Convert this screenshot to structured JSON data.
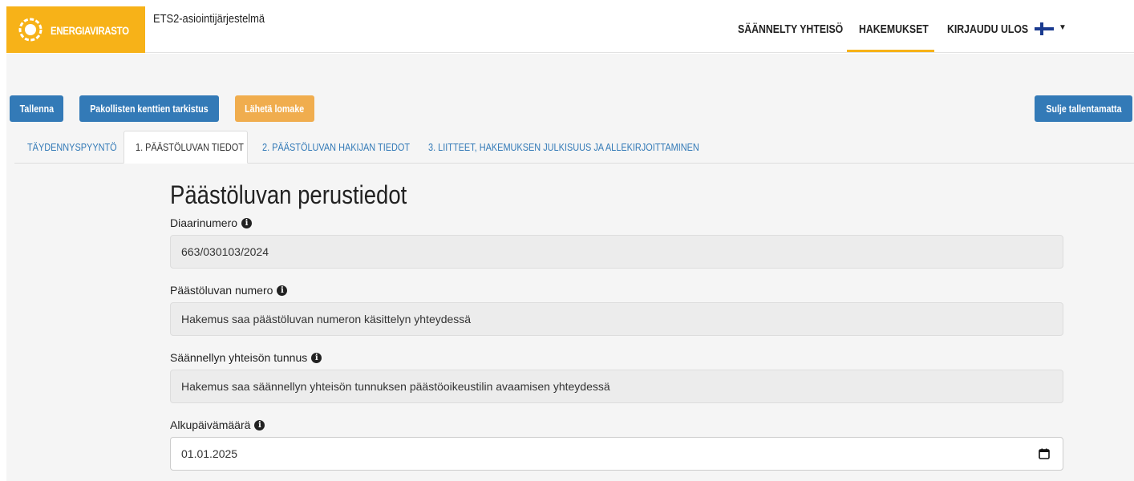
{
  "header": {
    "logo_text": "ENERGIAVIRASTO",
    "app_title": "ETS2-asiointijärjestelmä",
    "nav": [
      "SÄÄNNELTY YHTEISÖ",
      "HAKEMUKSET",
      "KIRJAUDU ULOS"
    ],
    "active_nav": "HAKEMUKSET",
    "language_icon": "finland-flag-icon",
    "accent_color": "#f7b218"
  },
  "toolbar": {
    "save_label": "Tallenna",
    "check_label": "Pakollisten kenttien tarkistus",
    "send_label": "Lähetä lomake",
    "close_label": "Sulje tallentamatta"
  },
  "tabs": [
    {
      "label": "TÄYDENNYSPYYNTÖ"
    },
    {
      "label": "1. PÄÄSTÖLUVAN TIEDOT"
    },
    {
      "label": "2. PÄÄSTÖLUVAN HAKIJAN TIEDOT"
    },
    {
      "label": "3. LIITTEET, HAKEMUKSEN JULKISUUS JA ALLEKIRJOITTAMINEN"
    }
  ],
  "active_tab": "1. PÄÄSTÖLUVAN TIEDOT",
  "form": {
    "title": "Päästöluvan perustiedot",
    "fields": [
      {
        "label": "Diaarinumero",
        "value": "663/030103/2024"
      },
      {
        "label": "Päästöluvan numero",
        "value": "Hakemus saa päästöluvan numeron käsittelyn yhteydessä"
      },
      {
        "label": "Säännellyn yhteisön tunnus",
        "value": "Hakemus saa säännellyn yhteisön tunnuksen päästöoikeustilin avaamisen yhteydessä"
      },
      {
        "label": "Alkupäivämäärä",
        "value": "01.01.2025"
      }
    ]
  },
  "colors": {
    "primary": "#337ab7",
    "warning": "#f0ad4e"
  }
}
